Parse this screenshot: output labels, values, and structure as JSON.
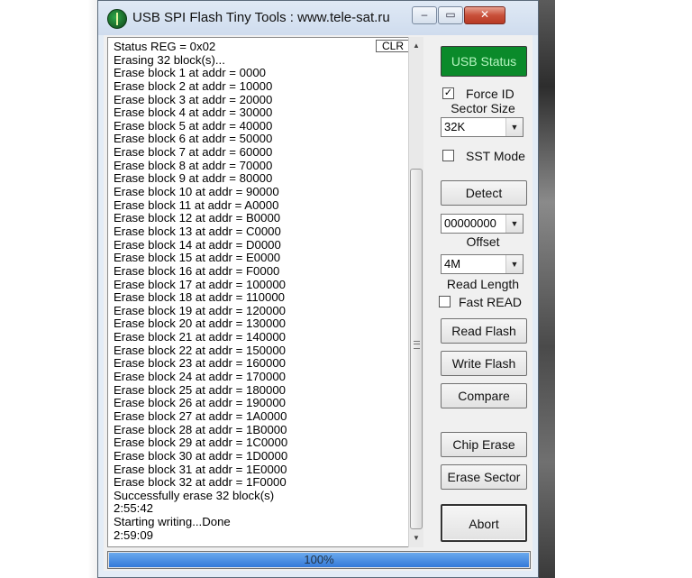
{
  "window": {
    "title": "USB SPI Flash Tiny Tools : www.tele-sat.ru",
    "minimize_glyph": "–",
    "maximize_glyph": "▭",
    "close_glyph": "✕"
  },
  "log": {
    "clear_label": "CLR",
    "lines": [
      "Status REG = 0x02",
      "Erasing 32 block(s)...",
      "Erase block 1 at addr = 0000",
      "Erase block 2 at addr = 10000",
      "Erase block 3 at addr = 20000",
      "Erase block 4 at addr = 30000",
      "Erase block 5 at addr = 40000",
      "Erase block 6 at addr = 50000",
      "Erase block 7 at addr = 60000",
      "Erase block 8 at addr = 70000",
      "Erase block 9 at addr = 80000",
      "Erase block 10 at addr = 90000",
      "Erase block 11 at addr = A0000",
      "Erase block 12 at addr = B0000",
      "Erase block 13 at addr = C0000",
      "Erase block 14 at addr = D0000",
      "Erase block 15 at addr = E0000",
      "Erase block 16 at addr = F0000",
      "Erase block 17 at addr = 100000",
      "Erase block 18 at addr = 110000",
      "Erase block 19 at addr = 120000",
      "Erase block 20 at addr = 130000",
      "Erase block 21 at addr = 140000",
      "Erase block 22 at addr = 150000",
      "Erase block 23 at addr = 160000",
      "Erase block 24 at addr = 170000",
      "Erase block 25 at addr = 180000",
      "Erase block 26 at addr = 190000",
      "Erase block 27 at addr = 1A0000",
      "Erase block 28 at addr = 1B0000",
      "Erase block 29 at addr = 1C0000",
      "Erase block 30 at addr = 1D0000",
      "Erase block 31 at addr = 1E0000",
      "Erase block 32 at addr = 1F0000",
      "Successfully erase 32 block(s)",
      "2:55:42",
      "Starting writing...Done",
      "2:59:09"
    ]
  },
  "panel": {
    "usb_status_label": "USB Status",
    "usb_status_color": "#0a8a2a",
    "force_id_label": "Force ID",
    "force_id_checked": true,
    "sector_size_label": "Sector Size",
    "sector_size_value": "32K",
    "sst_mode_label": "SST Mode",
    "sst_mode_checked": false,
    "detect_label": "Detect",
    "offset_value": "00000000",
    "offset_label": "Offset",
    "read_length_value": "4M",
    "read_length_label": "Read Length",
    "fast_read_label": "Fast READ",
    "fast_read_checked": false,
    "read_flash_label": "Read Flash",
    "write_flash_label": "Write Flash",
    "compare_label": "Compare",
    "chip_erase_label": "Chip Erase",
    "erase_sector_label": "Erase Sector",
    "abort_label": "Abort"
  },
  "progress": {
    "text": "100%",
    "fraction": 1.0,
    "color": "#3479d8"
  },
  "icons": {
    "check_glyph": "✓",
    "dropdown_glyph": "▼",
    "scroll_up_glyph": "▲",
    "scroll_down_glyph": "▼"
  }
}
